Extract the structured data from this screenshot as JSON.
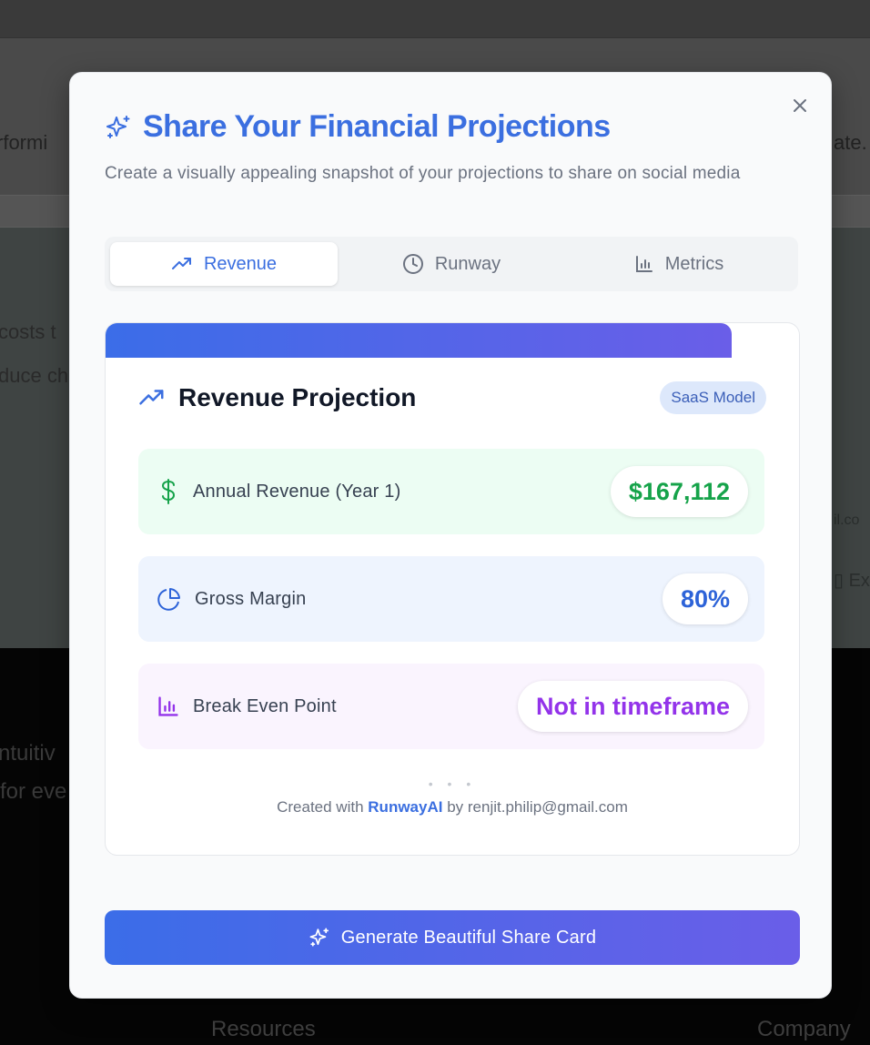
{
  "background": {
    "text_1": "rformi",
    "text_2": "ate.",
    "text_3": "costs t",
    "text_4": "duce ch",
    "text_5": "il.co",
    "text_6": "Ex",
    "text_7": "ntuitiv",
    "text_8": "for eve",
    "footer_col_1": "Resources",
    "footer_col_2": "Company"
  },
  "modal": {
    "title": "Share Your Financial Projections",
    "subtitle": "Create a visually appealing snapshot of your projections to share on social media",
    "close_icon": "x-icon"
  },
  "tabs": [
    {
      "label": "Revenue",
      "icon": "trending-up-icon",
      "active": true
    },
    {
      "label": "Runway",
      "icon": "clock-icon",
      "active": false
    },
    {
      "label": "Metrics",
      "icon": "bar-chart-icon",
      "active": false
    }
  ],
  "card": {
    "title": "Revenue Projection",
    "badge": "SaaS Model",
    "metrics": [
      {
        "label": "Annual Revenue (Year 1)",
        "value": "$167,112",
        "icon": "dollar-icon",
        "color": "#16a34a"
      },
      {
        "label": "Gross Margin",
        "value": "80%",
        "icon": "pie-chart-icon",
        "color": "#2d63d8"
      },
      {
        "label": "Break Even Point",
        "value": "Not in timeframe",
        "icon": "bar-chart-icon",
        "color": "#9333ea"
      }
    ],
    "dots": "• • •",
    "footer_prefix": "Created with",
    "footer_brand": "RunwayAI",
    "footer_suffix": "by renjit.philip@gmail.com"
  },
  "generate_button": {
    "label": "Generate Beautiful Share Card",
    "icon": "sparkles-icon"
  },
  "colors": {
    "accent": "#3b6fe0",
    "gradient_start": "#3b6de8",
    "gradient_end": "#6a5ee8"
  }
}
